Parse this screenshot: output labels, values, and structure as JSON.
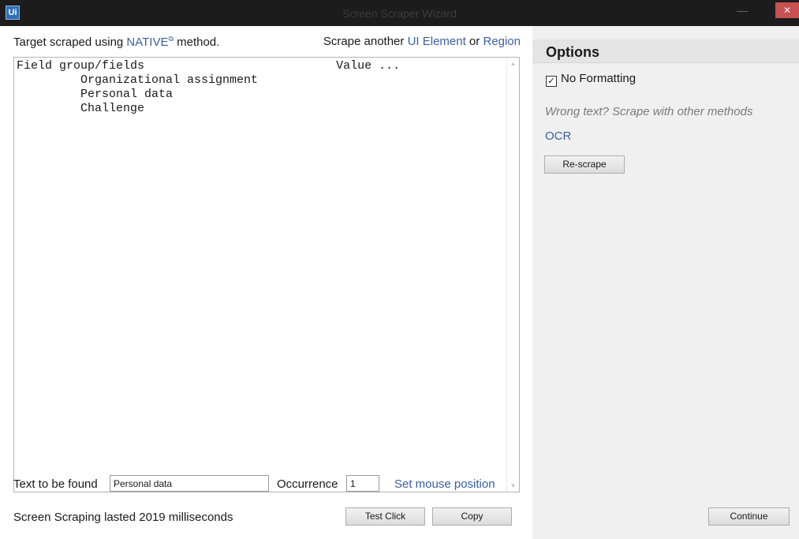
{
  "window": {
    "app_icon": "Ui",
    "title": "Screen Scraper Wizard",
    "minimize": "—",
    "close": "✕"
  },
  "target": {
    "prefix": "Target scraped using ",
    "method_link": "NATIVE",
    "ext_icon": "⧉",
    "suffix": " method."
  },
  "scrape_another": {
    "prefix": "Scrape another ",
    "ui_element_link": "UI Element",
    "or": " or ",
    "region_link": "Region"
  },
  "result_text": "Field group/fields                           Value ...\n         Organizational assignment\n         Personal data\n         Challenge",
  "find": {
    "label": "Text to be found",
    "value": "Personal data",
    "occurrence_label": "Occurrence",
    "occurrence_value": "1",
    "set_mouse_link": "Set mouse position"
  },
  "status": "Screen Scraping lasted 2019 milliseconds",
  "buttons": {
    "test_click": "Test Click",
    "copy": "Copy",
    "rescrape": "Re-scrape",
    "continue": "Continue"
  },
  "options": {
    "title": "Options",
    "no_formatting_label": "No Formatting",
    "no_formatting_checked": true,
    "checkmark": "✓",
    "wrong_text": "Wrong text? Scrape with other methods",
    "ocr_link": "OCR"
  },
  "scrollbar": {
    "up_arrow": "▲",
    "down_arrow": "▼"
  }
}
